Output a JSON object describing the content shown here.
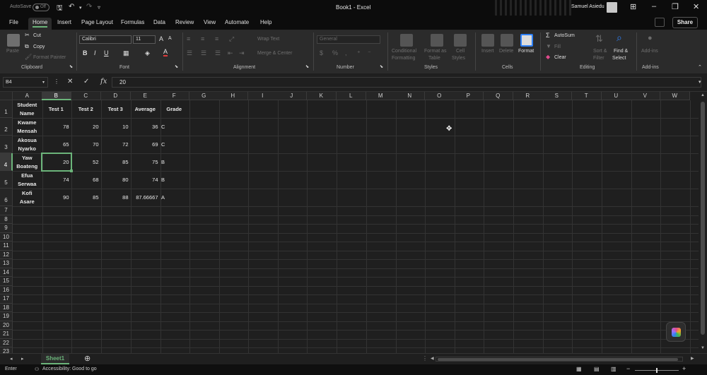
{
  "titlebar": {
    "autosave_label": "AutoSave",
    "autosave_state": "Off",
    "doc_title": "Book1  -  Excel",
    "user_name": "Samuel Asiedu"
  },
  "menu": {
    "tabs": [
      "File",
      "Home",
      "Insert",
      "Page Layout",
      "Formulas",
      "Data",
      "Review",
      "View",
      "Automate",
      "Help"
    ],
    "active": "Home",
    "share_label": "Share"
  },
  "ribbon": {
    "clipboard": {
      "paste": "Paste",
      "cut": "Cut",
      "copy": "Copy",
      "format_painter": "Format Painter",
      "label": "Clipboard"
    },
    "font": {
      "family": "Calibri",
      "size": "11",
      "label": "Font"
    },
    "alignment": {
      "wrap": "Wrap Text",
      "merge": "Merge & Center",
      "label": "Alignment"
    },
    "number": {
      "format": "General",
      "label": "Number"
    },
    "styles": {
      "conditional": "Conditional",
      "conditional2": "Formatting",
      "format_table": "Format as",
      "format_table2": "Table",
      "cell_styles": "Cell",
      "cell_styles2": "Styles",
      "label": "Styles"
    },
    "cells": {
      "insert": "Insert",
      "delete": "Delete",
      "format": "Format",
      "label": "Cells"
    },
    "editing": {
      "autosum": "AutoSum",
      "fill": "Fill",
      "clear": "Clear",
      "sort": "Sort &",
      "sort2": "Filter",
      "find": "Find &",
      "find2": "Select",
      "label": "Editing"
    },
    "addins": {
      "btn": "Add-ins",
      "label": "Add-ins"
    }
  },
  "formula_bar": {
    "name_box": "B4",
    "value": "20"
  },
  "grid": {
    "columns": [
      "A",
      "B",
      "C",
      "D",
      "E",
      "F",
      "G",
      "H",
      "I",
      "J",
      "K",
      "L",
      "M",
      "N",
      "O",
      "P",
      "Q",
      "R",
      "S",
      "T",
      "U",
      "V",
      "W"
    ],
    "rows": [
      "1",
      "2",
      "3",
      "4",
      "5",
      "6",
      "7",
      "8",
      "9",
      "10",
      "11",
      "12",
      "13",
      "14",
      "15",
      "16",
      "17",
      "18",
      "19",
      "20",
      "21",
      "22",
      "23"
    ],
    "selected_cell": "B4",
    "headers": [
      "Student Name",
      "Test 1",
      "Test 2",
      "Test 3",
      "Average",
      "Grade"
    ],
    "records": [
      {
        "name": "Kwame Mensah",
        "t1": "78",
        "t2": "20",
        "t3": "10",
        "avg": "36",
        "grade": "C"
      },
      {
        "name": "Akosua Nyarko",
        "t1": "65",
        "t2": "70",
        "t3": "72",
        "avg": "69",
        "grade": "C"
      },
      {
        "name": "Yaw Boateng",
        "t1": "20",
        "t2": "52",
        "t3": "85",
        "avg": "75",
        "grade": "B"
      },
      {
        "name": "Efua Serwaa",
        "t1": "74",
        "t2": "68",
        "t3": "80",
        "avg": "74",
        "grade": "B"
      },
      {
        "name": "Kofi Asare",
        "t1": "90",
        "t2": "85",
        "t3": "88",
        "avg": "87.66667",
        "grade": "A"
      }
    ]
  },
  "sheets": {
    "active": "Sheet1"
  },
  "status": {
    "mode": "Enter",
    "accessibility": "Accessibility: Good to go"
  },
  "colors": {
    "accent": "#6bb47a",
    "background": "#1f1f1f",
    "chrome": "#0c0c0c"
  }
}
